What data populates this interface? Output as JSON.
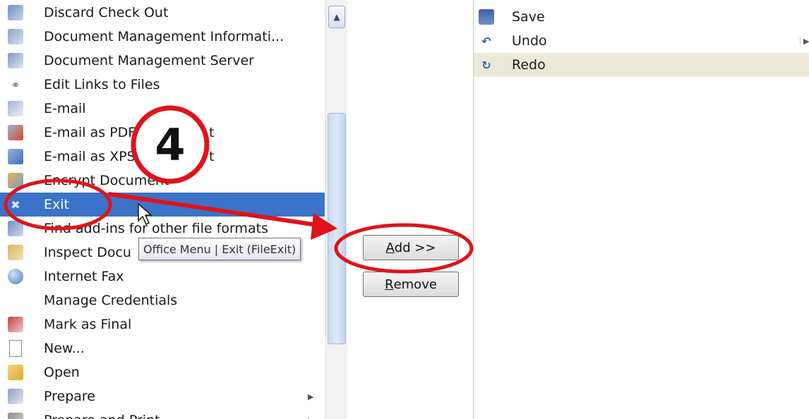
{
  "command_list": {
    "items": [
      {
        "label": "Discard Check Out",
        "icon": "document-arrow-icon"
      },
      {
        "label": "Document Management Informati...",
        "icon": "document-info-icon"
      },
      {
        "label": "Document Management Server",
        "icon": "server-document-icon"
      },
      {
        "label": "Edit Links to Files",
        "icon": "chain-link-icon"
      },
      {
        "label": "E-mail",
        "icon": "mail-icon"
      },
      {
        "label": "E-mail as PDF",
        "label_suffix": "t",
        "icon": "mail-pdf-icon"
      },
      {
        "label": "E-mail as XPS",
        "label_suffix": "t",
        "icon": "mail-xps-icon"
      },
      {
        "label": "Encrypt Document",
        "icon": "encrypt-icon"
      },
      {
        "label": "Exit",
        "icon": "exit-icon"
      },
      {
        "label": "Find add-ins for other file formats",
        "icon": "find-addins-icon"
      },
      {
        "label": "Inspect Docu",
        "icon": "inspect-icon"
      },
      {
        "label": "Internet Fax",
        "icon": "fax-globe-icon"
      },
      {
        "label": "Manage Credentials",
        "icon": ""
      },
      {
        "label": "Mark as Final",
        "icon": "mark-final-icon"
      },
      {
        "label": "New...",
        "icon": "new-document-icon"
      },
      {
        "label": "Open",
        "icon": "open-folder-icon"
      },
      {
        "label": "Prepare",
        "icon": "prepare-icon",
        "submenu": true
      },
      {
        "label": "Prepare and Print",
        "icon": "print-icon",
        "submenu": true
      }
    ],
    "selected_index": 8
  },
  "tooltip": "Office Menu | Exit (FileExit)",
  "buttons": {
    "add_label": "Add >>",
    "remove_label": "Remove"
  },
  "quick_access": {
    "items": [
      {
        "label": "Save",
        "icon": "save-icon"
      },
      {
        "label": "Undo",
        "icon": "undo-icon",
        "split": true
      },
      {
        "label": "Redo",
        "icon": "redo-icon"
      }
    ],
    "highlight_index": 2
  },
  "annotation": {
    "step": "4",
    "color": "#e0131b"
  },
  "colors": {
    "selection": "#3a73c8",
    "highlight": "#ece9d8"
  }
}
